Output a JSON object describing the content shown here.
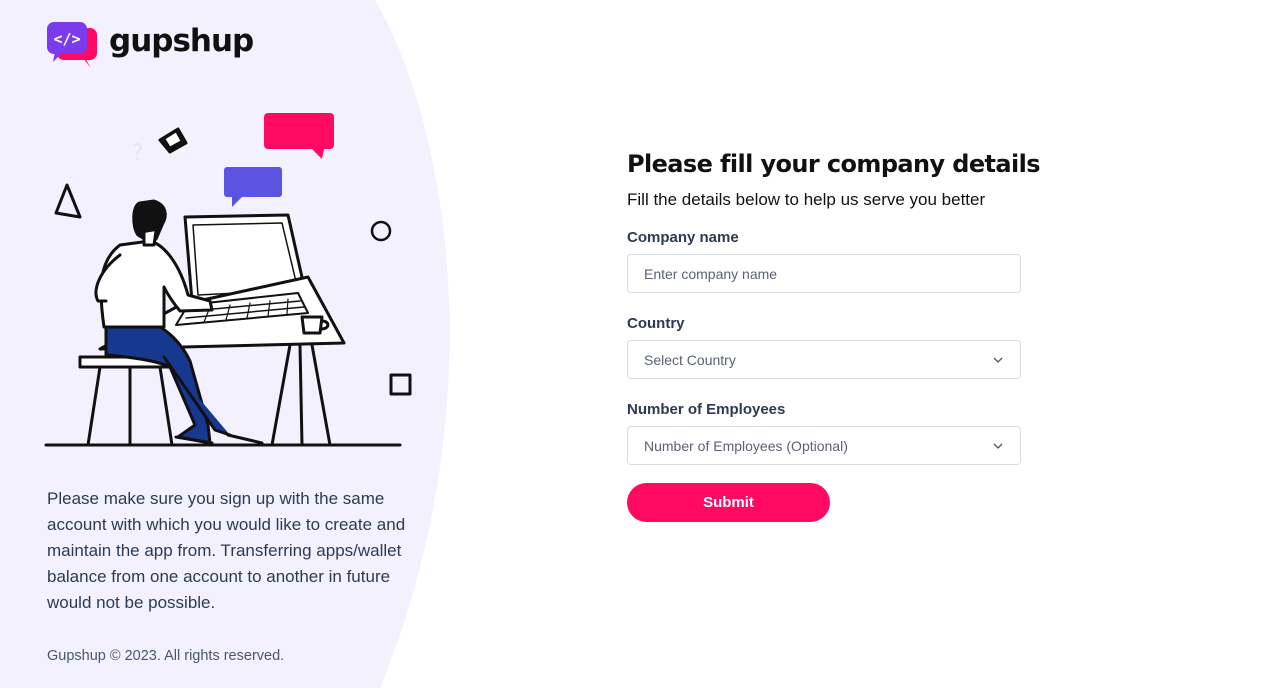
{
  "brand": {
    "name": "gupshup",
    "logo_text": "</>",
    "logo_icon": "code-chat-bubble-icon"
  },
  "left_panel": {
    "notice": "Please make sure you sign up with the same account with which you would like to create and maintain the app from. Transferring apps/wallet balance from one account to another in future would not be possible.",
    "footer": "Gupshup © 2023. All rights reserved.",
    "illustration_icon": "person-at-computer-illustration"
  },
  "form": {
    "title": "Please fill your company details",
    "subtitle": "Fill the details below to help us serve you better",
    "company": {
      "label": "Company name",
      "placeholder": "Enter company name",
      "value": ""
    },
    "country": {
      "label": "Country",
      "selected": "Select Country"
    },
    "employees": {
      "label": "Number of Employees",
      "selected": "Number of Employees (Optional)"
    },
    "submit_label": "Submit"
  },
  "colors": {
    "accent": "#ff0a63",
    "brand_purple": "#7c3aed",
    "panel_bg": "#f3f1fe",
    "chat_blue": "#5b54e3"
  }
}
